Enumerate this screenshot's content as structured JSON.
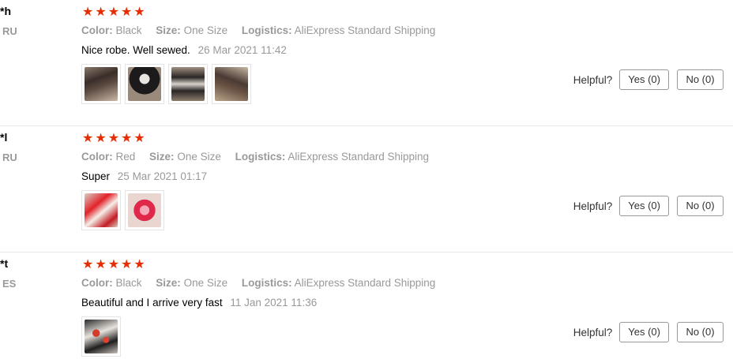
{
  "reviews": [
    {
      "user": "*h",
      "country": "RU",
      "stars": [
        "★",
        "★",
        "★",
        "★",
        "★"
      ],
      "attributes": [
        {
          "label": "Color:",
          "value": "Black"
        },
        {
          "label": "Size:",
          "value": "One Size"
        },
        {
          "label": "Logistics:",
          "value": "AliExpress Standard Shipping"
        }
      ],
      "text": "Nice robe. Well sewed.",
      "date": "26 Mar 2021 11:42",
      "helpful_label": "Helpful?",
      "yes_label": "Yes (0)",
      "no_label": "No (0)"
    },
    {
      "user": "*l",
      "country": "RU",
      "stars": [
        "★",
        "★",
        "★",
        "★",
        "★"
      ],
      "attributes": [
        {
          "label": "Color:",
          "value": "Red"
        },
        {
          "label": "Size:",
          "value": "One Size"
        },
        {
          "label": "Logistics:",
          "value": "AliExpress Standard Shipping"
        }
      ],
      "text": "Super",
      "date": "25 Mar 2021 01:17",
      "helpful_label": "Helpful?",
      "yes_label": "Yes (0)",
      "no_label": "No (0)"
    },
    {
      "user": "*t",
      "country": "ES",
      "stars": [
        "★",
        "★",
        "★",
        "★",
        "★"
      ],
      "attributes": [
        {
          "label": "Color:",
          "value": "Black"
        },
        {
          "label": "Size:",
          "value": "One Size"
        },
        {
          "label": "Logistics:",
          "value": "AliExpress Standard Shipping"
        }
      ],
      "text": "Beautiful and I arrive very fast",
      "date": "11 Jan 2021 11:36",
      "helpful_label": "Helpful?",
      "yes_label": "Yes (0)",
      "no_label": "No (0)"
    }
  ],
  "colors": {
    "star": "#e62e04",
    "muted_text": "#999999",
    "divider": "#e8e8e8"
  },
  "icons": {
    "star": "star-icon"
  }
}
